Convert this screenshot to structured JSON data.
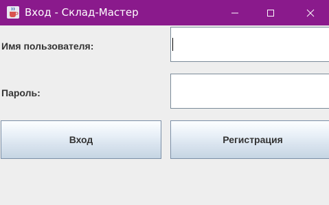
{
  "window": {
    "title": "Вход - Склад-Мастер",
    "app_icon": "java-cup-icon",
    "controls": {
      "minimize_icon": "minimize-icon",
      "maximize_icon": "maximize-icon",
      "close_icon": "close-icon"
    }
  },
  "form": {
    "username_label": "Имя пользователя:",
    "username_value": "",
    "password_label": "Пароль:",
    "password_value": ""
  },
  "buttons": {
    "login_label": "Вход",
    "register_label": "Регистрация"
  },
  "colors": {
    "titlebar": "#8a1a8c",
    "background": "#eeeeee",
    "text": "#333333"
  }
}
